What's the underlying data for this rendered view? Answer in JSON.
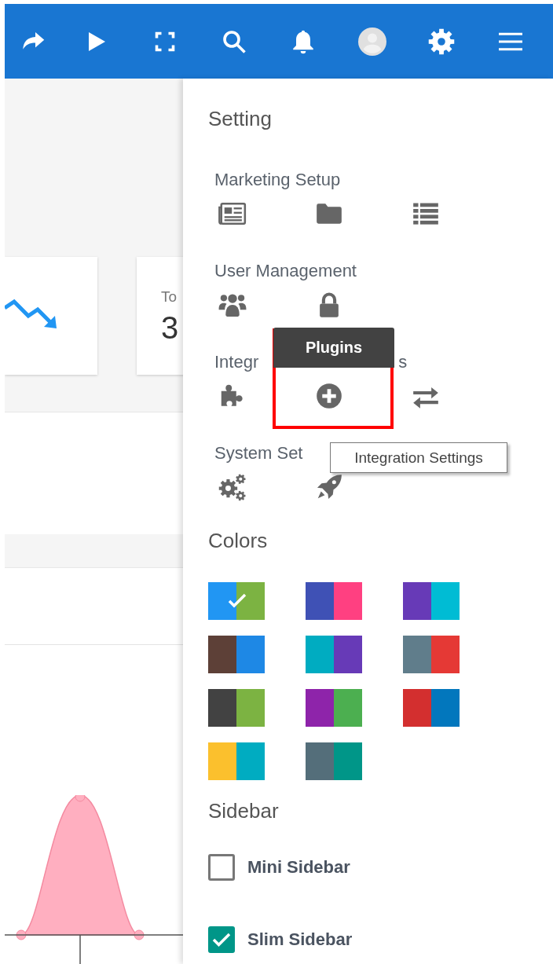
{
  "dashboard": {
    "cards": [
      {
        "kind": "trend"
      },
      {
        "kind": "stat",
        "label": "To",
        "value": "3"
      }
    ]
  },
  "settings_panel": {
    "title": "Setting",
    "sections": [
      {
        "title": "Marketing Setup",
        "icons": [
          {
            "kind": "newspaper",
            "highlighted": false
          },
          {
            "kind": "folder",
            "highlighted": false
          },
          {
            "kind": "list",
            "highlighted": false
          }
        ]
      },
      {
        "title": "User Management",
        "icons": [
          {
            "kind": "users",
            "highlighted": false
          },
          {
            "kind": "lock",
            "highlighted": false
          }
        ]
      },
      {
        "title": "Integr",
        "title_end": "s",
        "icons": [
          {
            "kind": "puzzle",
            "highlighted": false
          },
          {
            "kind": "plus",
            "highlighted": true
          },
          {
            "kind": "exchange",
            "highlighted": false
          }
        ]
      },
      {
        "title": "System Set",
        "icons": [
          {
            "kind": "gears",
            "highlighted": false
          },
          {
            "kind": "rocket",
            "highlighted": false
          }
        ]
      }
    ],
    "colors": {
      "title": "Colors",
      "swatches": [
        {
          "parts": [
            {
              "color": "#2196f3"
            },
            {
              "color": "#7cb342"
            }
          ],
          "selected": true
        },
        {
          "parts": [
            {
              "color": "#3f51b5"
            },
            {
              "color": "#ff4081"
            }
          ],
          "selected": false
        },
        {
          "parts": [
            {
              "color": "#673ab7"
            },
            {
              "color": "#00bcd4"
            }
          ],
          "selected": false
        },
        {
          "parts": [
            {
              "color": "#5d4037"
            },
            {
              "color": "#1e88e5"
            }
          ],
          "selected": false
        },
        {
          "parts": [
            {
              "color": "#00acc1"
            },
            {
              "color": "#673ab7"
            }
          ],
          "selected": false
        },
        {
          "parts": [
            {
              "color": "#607d8b"
            },
            {
              "color": "#e53935"
            }
          ],
          "selected": false
        },
        {
          "parts": [
            {
              "color": "#424242"
            },
            {
              "color": "#7cb342"
            }
          ],
          "selected": false
        },
        {
          "parts": [
            {
              "color": "#8e24aa"
            },
            {
              "color": "#4caf50"
            }
          ],
          "selected": false
        },
        {
          "parts": [
            {
              "color": "#d32f2f"
            },
            {
              "color": "#0277bd"
            }
          ],
          "selected": false
        },
        {
          "parts": [
            {
              "color": "#fbc02d"
            },
            {
              "color": "#00acc1"
            }
          ],
          "selected": false
        },
        {
          "parts": [
            {
              "color": "#546e7a"
            },
            {
              "color": "#009688"
            }
          ],
          "selected": false
        }
      ]
    },
    "sidebar": {
      "title": "Sidebar",
      "options": [
        {
          "label": "Mini Sidebar",
          "checked": false
        },
        {
          "label": "Slim Sidebar",
          "checked": true
        }
      ]
    },
    "tooltips": [
      {
        "kind": "dark",
        "text": "Plugins"
      },
      {
        "kind": "light",
        "text": "Integration Settings"
      }
    ]
  }
}
